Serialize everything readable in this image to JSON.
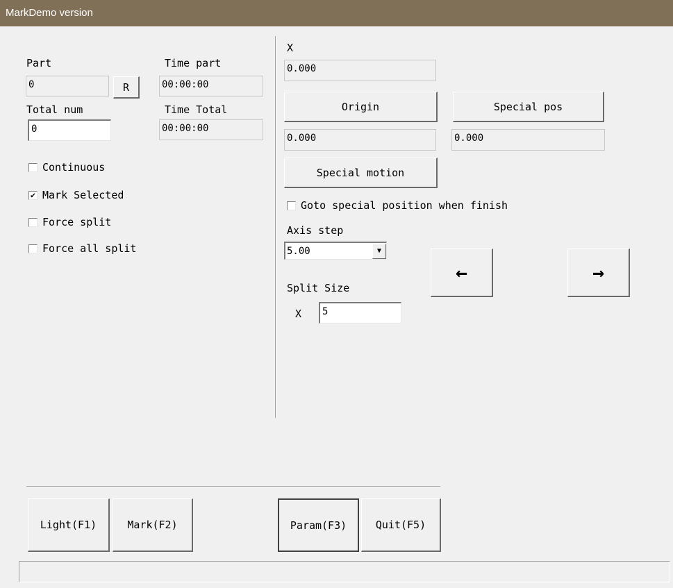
{
  "window": {
    "title": "MarkDemo version"
  },
  "left": {
    "part_label": "Part",
    "part_value": "0",
    "reset_label": "R",
    "time_part_label": "Time part",
    "time_part_value": "00:00:00",
    "total_num_label": "Total num",
    "total_num_value": "0",
    "time_total_label": "Time Total",
    "time_total_value": "00:00:00",
    "checkboxes": [
      {
        "label": "Continuous",
        "checked": false,
        "mark": ""
      },
      {
        "label": "Mark Selected",
        "checked": true,
        "mark": "✔"
      },
      {
        "label": "Force split",
        "checked": false,
        "mark": ""
      },
      {
        "label": "Force all split",
        "checked": false,
        "mark": ""
      }
    ]
  },
  "right": {
    "x_label": "X",
    "x_value": "0.000",
    "origin_label": "Origin",
    "special_pos_label": "Special pos",
    "origin_value": "0.000",
    "special_pos_value": "0.000",
    "special_motion_label": "Special motion",
    "goto_special_label": "Goto special position when finish",
    "goto_special_checked": false,
    "axis_step_label": "Axis step",
    "axis_step_value": "5.00",
    "left_arrow": "←",
    "right_arrow": "→",
    "split_size_label": "Split Size",
    "split_x_label": "X",
    "split_x_value": "5"
  },
  "bottom": {
    "light_label": "Light(F1)",
    "mark_label": "Mark(F2)",
    "param_label": "Param(F3)",
    "quit_label": "Quit(F5)",
    "status_text": ""
  },
  "icons": {
    "dropdown_arrow": "▼"
  }
}
